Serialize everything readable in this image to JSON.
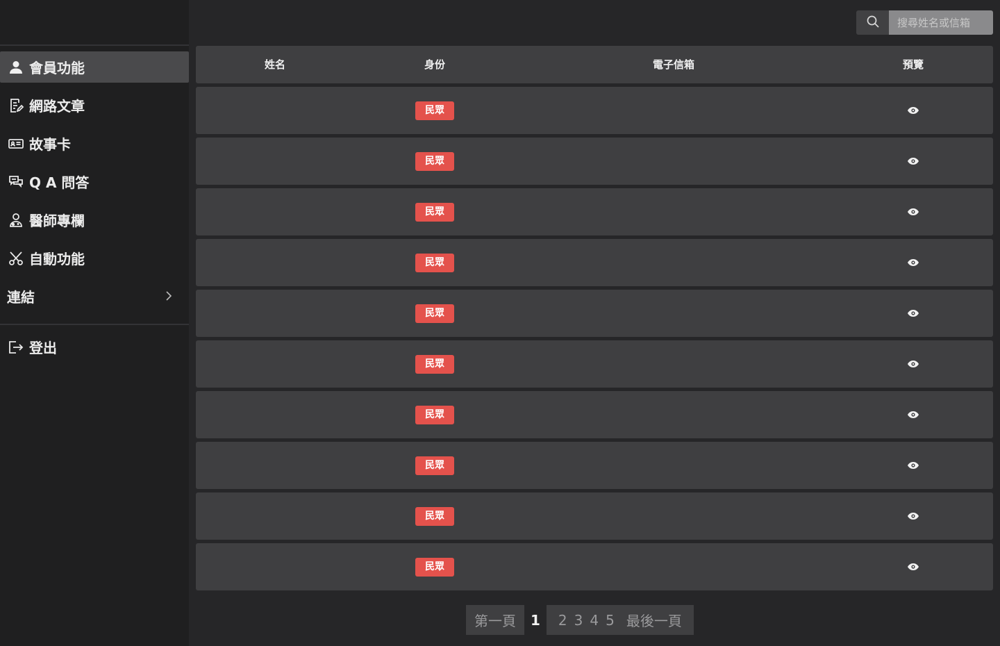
{
  "sidebar": {
    "items": [
      {
        "label": "會員功能",
        "icon": "user-icon",
        "active": true
      },
      {
        "label": "網路文章",
        "icon": "article-icon"
      },
      {
        "label": "故事卡",
        "icon": "id-card-icon"
      },
      {
        "label": "Q A 問答",
        "icon": "chat-icon"
      },
      {
        "label": "醫師專欄",
        "icon": "doctor-icon"
      },
      {
        "label": "自動功能",
        "icon": "scissors-icon"
      },
      {
        "label": "連結",
        "icon": "chevron-right-icon"
      }
    ],
    "logout_label": "登出"
  },
  "search": {
    "placeholder": "搜尋姓名或信箱"
  },
  "table": {
    "headers": {
      "name": "姓名",
      "role": "身份",
      "email": "電子信箱",
      "preview": "預覽"
    },
    "rows": [
      {
        "name": "",
        "role": "民眾",
        "email": ""
      },
      {
        "name": "",
        "role": "民眾",
        "email": ""
      },
      {
        "name": "",
        "role": "民眾",
        "email": ""
      },
      {
        "name": "",
        "role": "民眾",
        "email": ""
      },
      {
        "name": "",
        "role": "民眾",
        "email": ""
      },
      {
        "name": "",
        "role": "民眾",
        "email": ""
      },
      {
        "name": "",
        "role": "民眾",
        "email": ""
      },
      {
        "name": "",
        "role": "民眾",
        "email": ""
      },
      {
        "name": "",
        "role": "民眾",
        "email": ""
      },
      {
        "name": "",
        "role": "民眾",
        "email": ""
      }
    ]
  },
  "pagination": {
    "first": "第一頁",
    "current": "1",
    "pages": [
      "2",
      "3",
      "4",
      "5"
    ],
    "last": "最後一頁"
  },
  "colors": {
    "badge": "#e4524c",
    "row_bg": "#3f3f41",
    "sidebar_bg": "#1f1f20",
    "page_bg": "#262628"
  }
}
